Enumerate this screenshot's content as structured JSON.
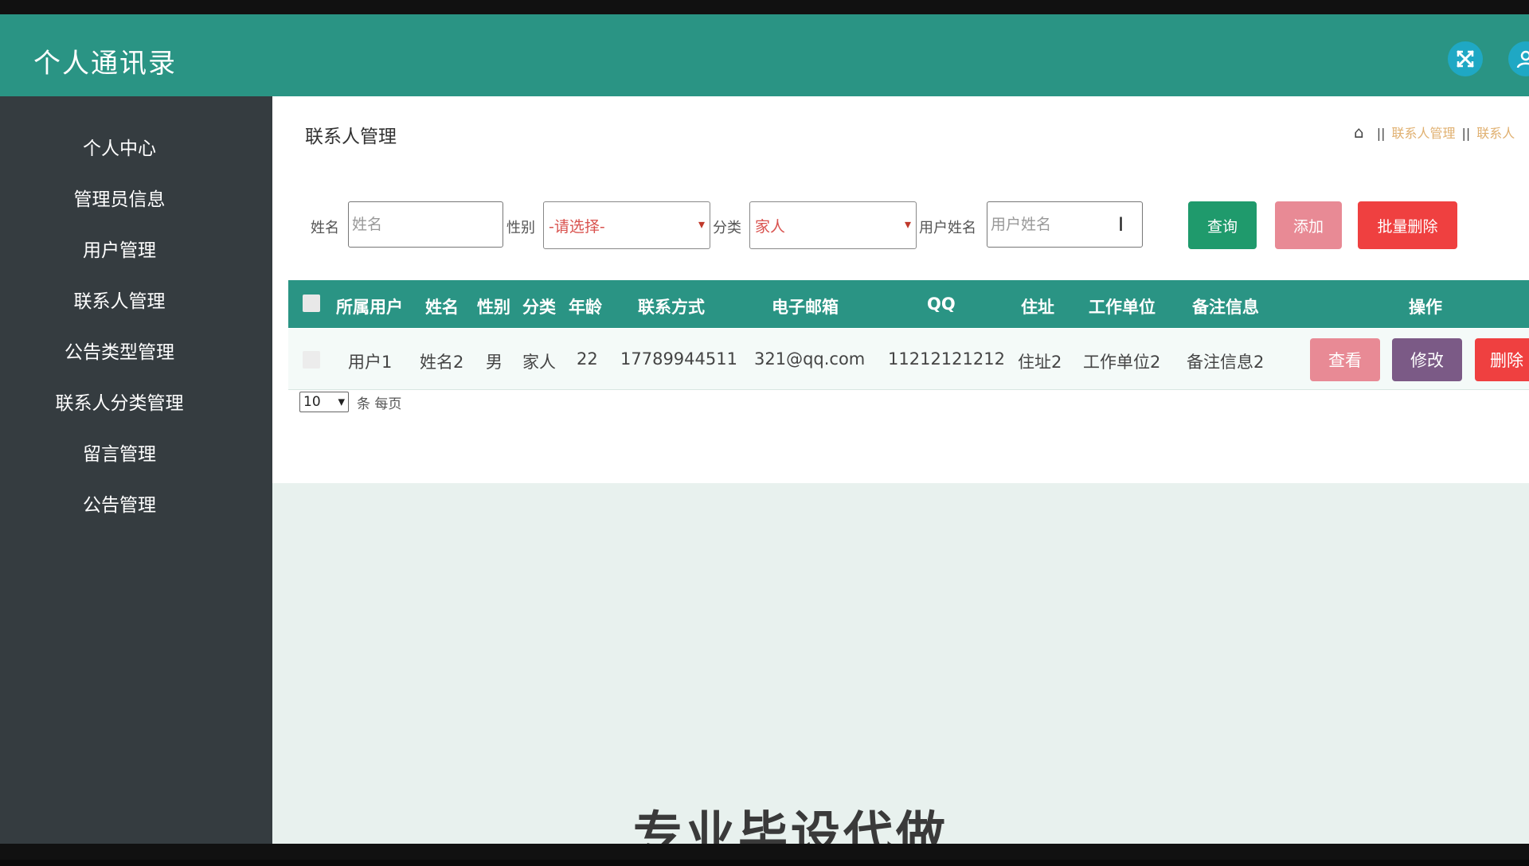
{
  "header": {
    "app_title": "个人通讯录",
    "fullscreen_icon": "expand-icon",
    "user_icon": "user-icon"
  },
  "sidebar": {
    "items": [
      {
        "label": "个人中心"
      },
      {
        "label": "管理员信息"
      },
      {
        "label": "用户管理"
      },
      {
        "label": "联系人管理"
      },
      {
        "label": "公告类型管理"
      },
      {
        "label": "联系人分类管理"
      },
      {
        "label": "留言管理"
      },
      {
        "label": "公告管理"
      }
    ]
  },
  "main": {
    "page_title": "联系人管理",
    "breadcrumb": {
      "home_icon": "home-icon",
      "items": [
        "联系人管理",
        "联系人"
      ]
    }
  },
  "search": {
    "name_label": "姓名",
    "name_placeholder": "姓名",
    "gender_label": "性别",
    "gender_value": "-请选择-",
    "category_label": "分类",
    "category_value": "家人",
    "username_label": "用户姓名",
    "username_placeholder": "用户姓名",
    "query_button": "查询",
    "add_button": "添加",
    "batch_delete_button": "批量删除"
  },
  "table": {
    "columns": [
      "所属用户",
      "姓名",
      "性别",
      "分类",
      "年龄",
      "联系方式",
      "电子邮箱",
      "QQ",
      "住址",
      "工作单位",
      "备注信息",
      "操作"
    ],
    "rows": [
      {
        "user": "用户1",
        "name": "姓名2",
        "gender": "男",
        "category": "家人",
        "age": "22",
        "phone": "17789944511",
        "email": "321@qq.com",
        "qq": "11212121212",
        "address": "住址2",
        "company": "工作单位2",
        "note": "备注信息2",
        "actions": {
          "view": "查看",
          "edit": "修改",
          "delete": "删除"
        }
      }
    ]
  },
  "pager": {
    "page_size": "10",
    "suffix": "条 每页"
  },
  "watermark": "专业毕设代做",
  "colors": {
    "header_bg": "#2a9484",
    "sidebar_bg": "#353c40",
    "query_btn": "#1f9a6c",
    "add_btn": "#e88a95",
    "delete_btn": "#ef4040",
    "edit_btn": "#7b5a86"
  }
}
